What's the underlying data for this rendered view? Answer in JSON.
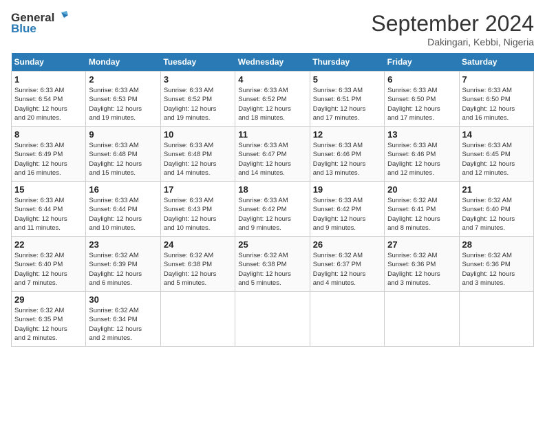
{
  "header": {
    "logo_line1": "General",
    "logo_line2": "Blue",
    "month": "September 2024",
    "location": "Dakingari, Kebbi, Nigeria"
  },
  "weekdays": [
    "Sunday",
    "Monday",
    "Tuesday",
    "Wednesday",
    "Thursday",
    "Friday",
    "Saturday"
  ],
  "weeks": [
    [
      {
        "day": "1",
        "info": "Sunrise: 6:33 AM\nSunset: 6:54 PM\nDaylight: 12 hours\nand 20 minutes."
      },
      {
        "day": "2",
        "info": "Sunrise: 6:33 AM\nSunset: 6:53 PM\nDaylight: 12 hours\nand 19 minutes."
      },
      {
        "day": "3",
        "info": "Sunrise: 6:33 AM\nSunset: 6:52 PM\nDaylight: 12 hours\nand 19 minutes."
      },
      {
        "day": "4",
        "info": "Sunrise: 6:33 AM\nSunset: 6:52 PM\nDaylight: 12 hours\nand 18 minutes."
      },
      {
        "day": "5",
        "info": "Sunrise: 6:33 AM\nSunset: 6:51 PM\nDaylight: 12 hours\nand 17 minutes."
      },
      {
        "day": "6",
        "info": "Sunrise: 6:33 AM\nSunset: 6:50 PM\nDaylight: 12 hours\nand 17 minutes."
      },
      {
        "day": "7",
        "info": "Sunrise: 6:33 AM\nSunset: 6:50 PM\nDaylight: 12 hours\nand 16 minutes."
      }
    ],
    [
      {
        "day": "8",
        "info": "Sunrise: 6:33 AM\nSunset: 6:49 PM\nDaylight: 12 hours\nand 16 minutes."
      },
      {
        "day": "9",
        "info": "Sunrise: 6:33 AM\nSunset: 6:48 PM\nDaylight: 12 hours\nand 15 minutes."
      },
      {
        "day": "10",
        "info": "Sunrise: 6:33 AM\nSunset: 6:48 PM\nDaylight: 12 hours\nand 14 minutes."
      },
      {
        "day": "11",
        "info": "Sunrise: 6:33 AM\nSunset: 6:47 PM\nDaylight: 12 hours\nand 14 minutes."
      },
      {
        "day": "12",
        "info": "Sunrise: 6:33 AM\nSunset: 6:46 PM\nDaylight: 12 hours\nand 13 minutes."
      },
      {
        "day": "13",
        "info": "Sunrise: 6:33 AM\nSunset: 6:46 PM\nDaylight: 12 hours\nand 12 minutes."
      },
      {
        "day": "14",
        "info": "Sunrise: 6:33 AM\nSunset: 6:45 PM\nDaylight: 12 hours\nand 12 minutes."
      }
    ],
    [
      {
        "day": "15",
        "info": "Sunrise: 6:33 AM\nSunset: 6:44 PM\nDaylight: 12 hours\nand 11 minutes."
      },
      {
        "day": "16",
        "info": "Sunrise: 6:33 AM\nSunset: 6:44 PM\nDaylight: 12 hours\nand 10 minutes."
      },
      {
        "day": "17",
        "info": "Sunrise: 6:33 AM\nSunset: 6:43 PM\nDaylight: 12 hours\nand 10 minutes."
      },
      {
        "day": "18",
        "info": "Sunrise: 6:33 AM\nSunset: 6:42 PM\nDaylight: 12 hours\nand 9 minutes."
      },
      {
        "day": "19",
        "info": "Sunrise: 6:33 AM\nSunset: 6:42 PM\nDaylight: 12 hours\nand 9 minutes."
      },
      {
        "day": "20",
        "info": "Sunrise: 6:32 AM\nSunset: 6:41 PM\nDaylight: 12 hours\nand 8 minutes."
      },
      {
        "day": "21",
        "info": "Sunrise: 6:32 AM\nSunset: 6:40 PM\nDaylight: 12 hours\nand 7 minutes."
      }
    ],
    [
      {
        "day": "22",
        "info": "Sunrise: 6:32 AM\nSunset: 6:40 PM\nDaylight: 12 hours\nand 7 minutes."
      },
      {
        "day": "23",
        "info": "Sunrise: 6:32 AM\nSunset: 6:39 PM\nDaylight: 12 hours\nand 6 minutes."
      },
      {
        "day": "24",
        "info": "Sunrise: 6:32 AM\nSunset: 6:38 PM\nDaylight: 12 hours\nand 5 minutes."
      },
      {
        "day": "25",
        "info": "Sunrise: 6:32 AM\nSunset: 6:38 PM\nDaylight: 12 hours\nand 5 minutes."
      },
      {
        "day": "26",
        "info": "Sunrise: 6:32 AM\nSunset: 6:37 PM\nDaylight: 12 hours\nand 4 minutes."
      },
      {
        "day": "27",
        "info": "Sunrise: 6:32 AM\nSunset: 6:36 PM\nDaylight: 12 hours\nand 3 minutes."
      },
      {
        "day": "28",
        "info": "Sunrise: 6:32 AM\nSunset: 6:36 PM\nDaylight: 12 hours\nand 3 minutes."
      }
    ],
    [
      {
        "day": "29",
        "info": "Sunrise: 6:32 AM\nSunset: 6:35 PM\nDaylight: 12 hours\nand 2 minutes."
      },
      {
        "day": "30",
        "info": "Sunrise: 6:32 AM\nSunset: 6:34 PM\nDaylight: 12 hours\nand 2 minutes."
      },
      null,
      null,
      null,
      null,
      null
    ]
  ]
}
